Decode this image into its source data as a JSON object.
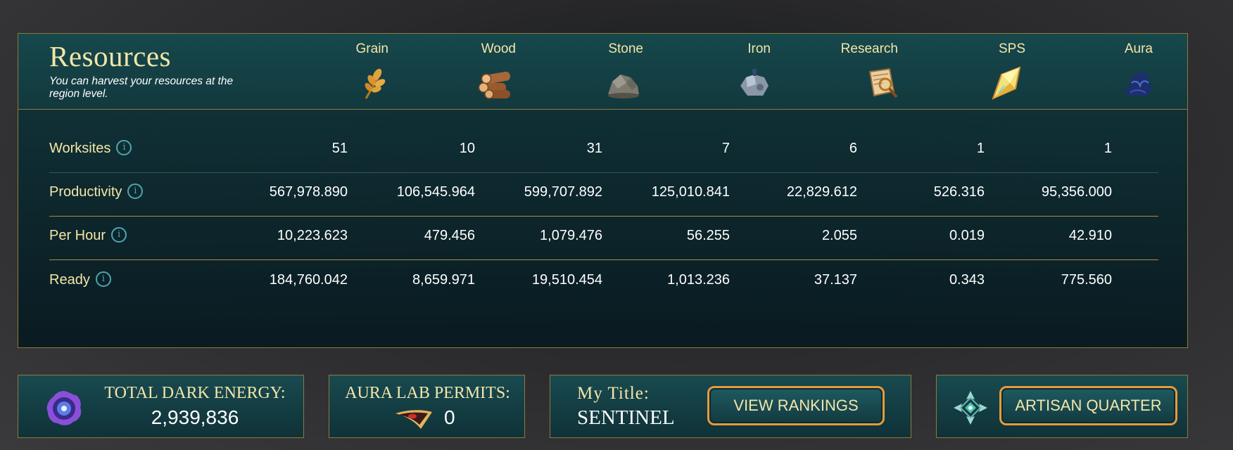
{
  "resources": {
    "title": "Resources",
    "subtitle": "You can harvest your resources at the region level.",
    "columns": [
      {
        "name": "Grain",
        "icon": "grain-icon"
      },
      {
        "name": "Wood",
        "icon": "wood-icon"
      },
      {
        "name": "Stone",
        "icon": "stone-icon"
      },
      {
        "name": "Iron",
        "icon": "iron-icon"
      },
      {
        "name": "Research",
        "icon": "research-icon"
      },
      {
        "name": "SPS",
        "icon": "sps-icon"
      },
      {
        "name": "Aura",
        "icon": "aura-icon"
      }
    ],
    "rows": [
      {
        "label": "Worksites",
        "values": [
          "51",
          "10",
          "31",
          "7",
          "6",
          "1",
          "1"
        ]
      },
      {
        "label": "Productivity",
        "values": [
          "567,978.890",
          "106,545.964",
          "599,707.892",
          "125,010.841",
          "22,829.612",
          "526.316",
          "95,356.000"
        ]
      },
      {
        "label": "Per Hour",
        "values": [
          "10,223.623",
          "479.456",
          "1,079.476",
          "56.255",
          "2.055",
          "0.019",
          "42.910"
        ]
      },
      {
        "label": "Ready",
        "values": [
          "184,760.042",
          "8,659.971",
          "19,510.454",
          "1,013.236",
          "37.137",
          "0.343",
          "775.560"
        ]
      }
    ]
  },
  "dark_energy": {
    "label": "TOTAL DARK ENERGY:",
    "value": "2,939,836"
  },
  "permits": {
    "label": "AURA LAB PERMITS:",
    "value": "0"
  },
  "title_box": {
    "label": "My Title:",
    "value": "SENTINEL",
    "button": "VIEW RANKINGS"
  },
  "artisan": {
    "button": "ARTISAN QUARTER"
  },
  "info_glyph": "i",
  "colors": {
    "gold_text": "#f3e6a8",
    "border_gold": "#8c7a3e",
    "button_orange": "#e69a3c",
    "info_teal": "#4ea5b0"
  }
}
